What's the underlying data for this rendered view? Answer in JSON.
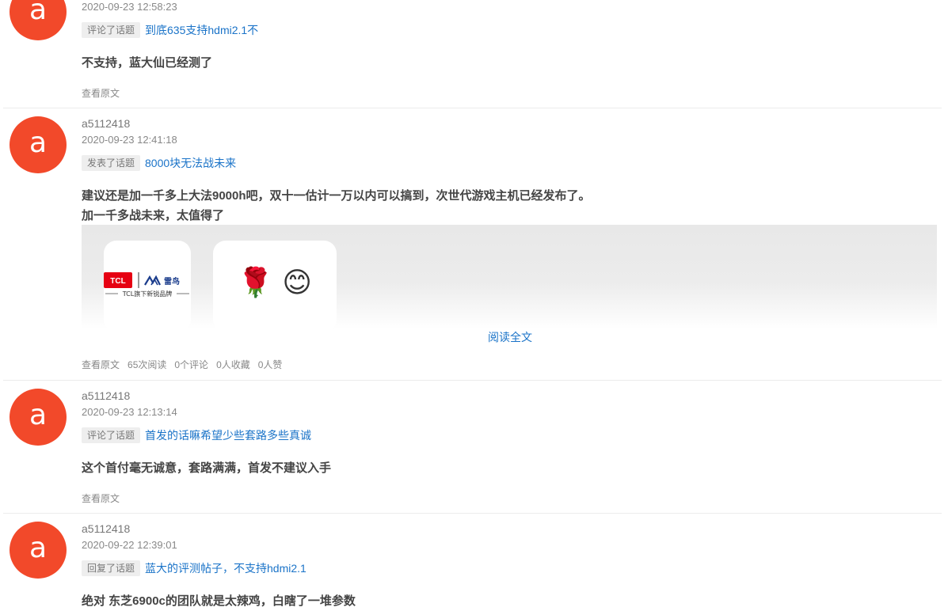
{
  "posts": [
    {
      "avatar_letter": "a",
      "time": "2020-09-23 12:58:23",
      "action": "评论了话题",
      "topic": "到底635支持hdmi2.1不",
      "content": [
        "不支持，蓝大仙已经测了"
      ],
      "view_original": "查看原文"
    },
    {
      "avatar_letter": "a",
      "user": "a5112418",
      "time": "2020-09-23 12:41:18",
      "action": "发表了话题",
      "topic": "8000块无法战未来",
      "content": [
        "建议还是加一千多上大法9000h吧，双十一估计一万以内可以搞到，次世代游戏主机已经发布了。",
        "加一千多战未来，太值得了"
      ],
      "logo": {
        "brand": "TCL",
        "sub_brand": "雷鸟",
        "tagline": "TCL旗下新锐品牌"
      },
      "emoji": "🌹 😊",
      "read_more": "阅读全文",
      "view_original": "查看原文",
      "reads": "65次阅读",
      "comments": "0个评论",
      "favorites": "0人收藏",
      "likes": "0人赞"
    },
    {
      "avatar_letter": "a",
      "user": "a5112418",
      "time": "2020-09-23 12:13:14",
      "action": "评论了话题",
      "topic": "首发的话嘛希望少些套路多些真诚",
      "content": [
        "这个首付毫无诚意，套路满满，首发不建议入手"
      ],
      "view_original": "查看原文"
    },
    {
      "avatar_letter": "a",
      "user": "a5112418",
      "time": "2020-09-22 12:39:01",
      "action": "回复了话题",
      "topic": "蓝大的评测帖子，不支持hdmi2.1",
      "content": [
        "绝对 东芝6900c的团队就是太辣鸡，白瞎了一堆参数"
      ]
    }
  ],
  "colors": {
    "avatar": "#f2492a",
    "link": "#1a73c8",
    "tcl_red": "#e60012"
  }
}
